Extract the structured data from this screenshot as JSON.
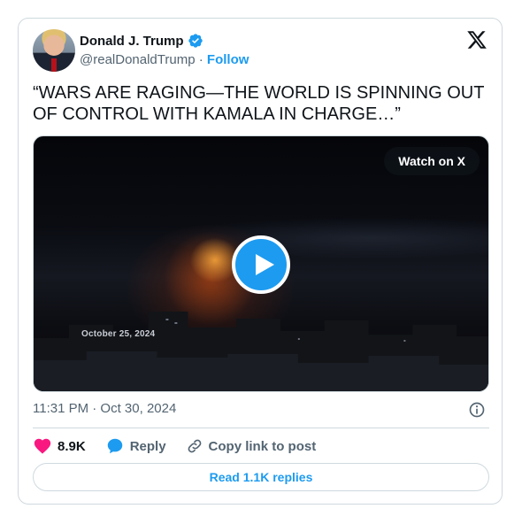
{
  "author": {
    "display_name": "Donald J. Trump",
    "handle": "@realDonaldTrump",
    "separator": "·",
    "follow_label": "Follow",
    "verified": true
  },
  "tweet": {
    "text": "“WARS ARE RAGING—THE WORLD IS SPINNING OUT OF CONTROL WITH KAMALA IN CHARGE…”"
  },
  "media": {
    "watch_label": "Watch on X",
    "overlay_date": "October 25, 2024"
  },
  "meta": {
    "timestamp": "11:31 PM · Oct 30, 2024"
  },
  "actions": {
    "likes_count": "8.9K",
    "reply_label": "Reply",
    "copy_label": "Copy link to post"
  },
  "footer": {
    "read_replies_label": "Read 1.1K replies"
  },
  "colors": {
    "accent": "#1d9bf0",
    "like": "#f91880",
    "border": "#cfd9de",
    "secondary_text": "#536471"
  },
  "icons": [
    "verified-badge-icon",
    "x-logo-icon",
    "play-icon",
    "info-icon",
    "heart-icon",
    "reply-bubble-icon",
    "link-icon"
  ]
}
